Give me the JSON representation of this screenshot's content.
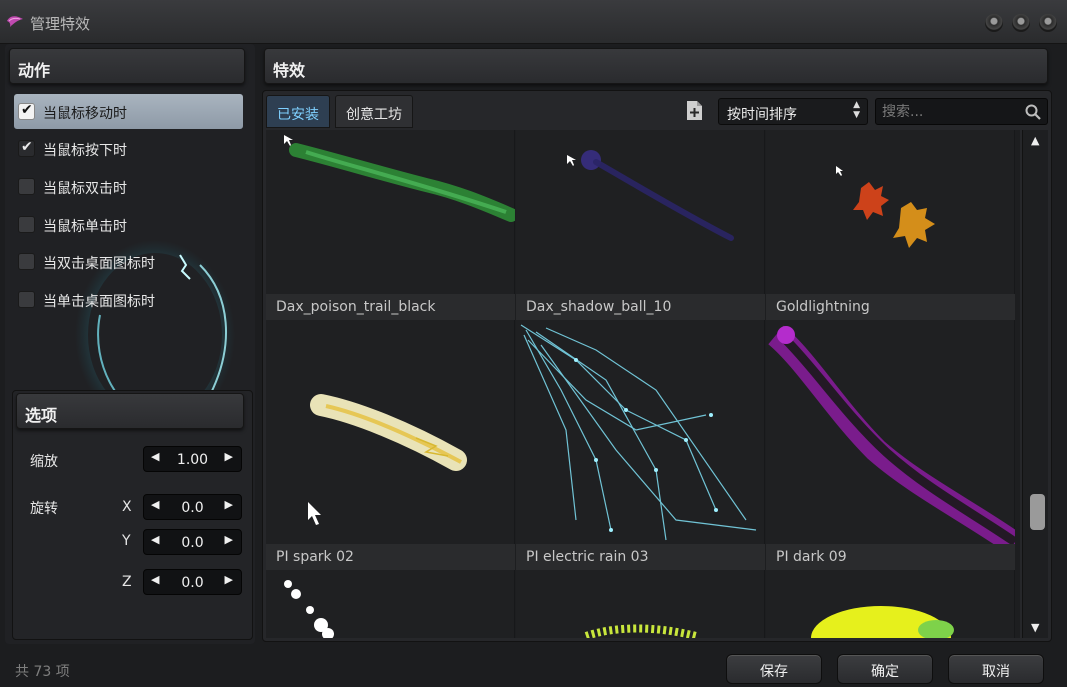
{
  "window": {
    "title": "管理特效"
  },
  "actions_panel": {
    "title": "动作",
    "items": [
      {
        "label": "当鼠标移动时",
        "checked": true,
        "selected": true
      },
      {
        "label": "当鼠标按下时",
        "checked": true,
        "selected": false
      },
      {
        "label": "当鼠标双击时",
        "checked": false,
        "selected": false
      },
      {
        "label": "当鼠标单击时",
        "checked": false,
        "selected": false
      },
      {
        "label": "当双击桌面图标时",
        "checked": false,
        "selected": false
      },
      {
        "label": "当单击桌面图标时",
        "checked": false,
        "selected": false
      }
    ]
  },
  "options_panel": {
    "title": "选项",
    "scale_label": "缩放",
    "scale_value": "1.00",
    "rotate_label": "旋转",
    "x_label": "X",
    "x_value": "0.0",
    "y_label": "Y",
    "y_value": "0.0",
    "z_label": "Z",
    "z_value": "0.0"
  },
  "effects_panel": {
    "title": "特效",
    "tabs": [
      {
        "label": "已安装",
        "active": true
      },
      {
        "label": "创意工坊",
        "active": false
      }
    ],
    "sort_select": "按时间排序",
    "search_placeholder": "搜索...",
    "effects": [
      {
        "name": "Dax_poison_trail_black",
        "color": "#2f9a3a"
      },
      {
        "name": "Dax_shadow_ball_10",
        "color": "#2a2566"
      },
      {
        "name": "Goldlightning",
        "color": "#e06a1a"
      },
      {
        "name": "PI spark 02",
        "color": "#fff3b0"
      },
      {
        "name": "PI electric rain 03",
        "color": "#7fe0f5"
      },
      {
        "name": "PI dark 09",
        "color": "#9a1bb0"
      },
      {
        "name": "",
        "color": "#ffffff"
      },
      {
        "name": "",
        "color": "#c8e63c"
      },
      {
        "name": "",
        "color": "#e6f01c"
      }
    ]
  },
  "footer": {
    "count_text": "共 73 项",
    "save_label": "保存",
    "ok_label": "确定",
    "cancel_label": "取消"
  },
  "colors": {
    "accent_tab_text": "#7fd0ff",
    "selected_row": "#9aa6b3"
  }
}
